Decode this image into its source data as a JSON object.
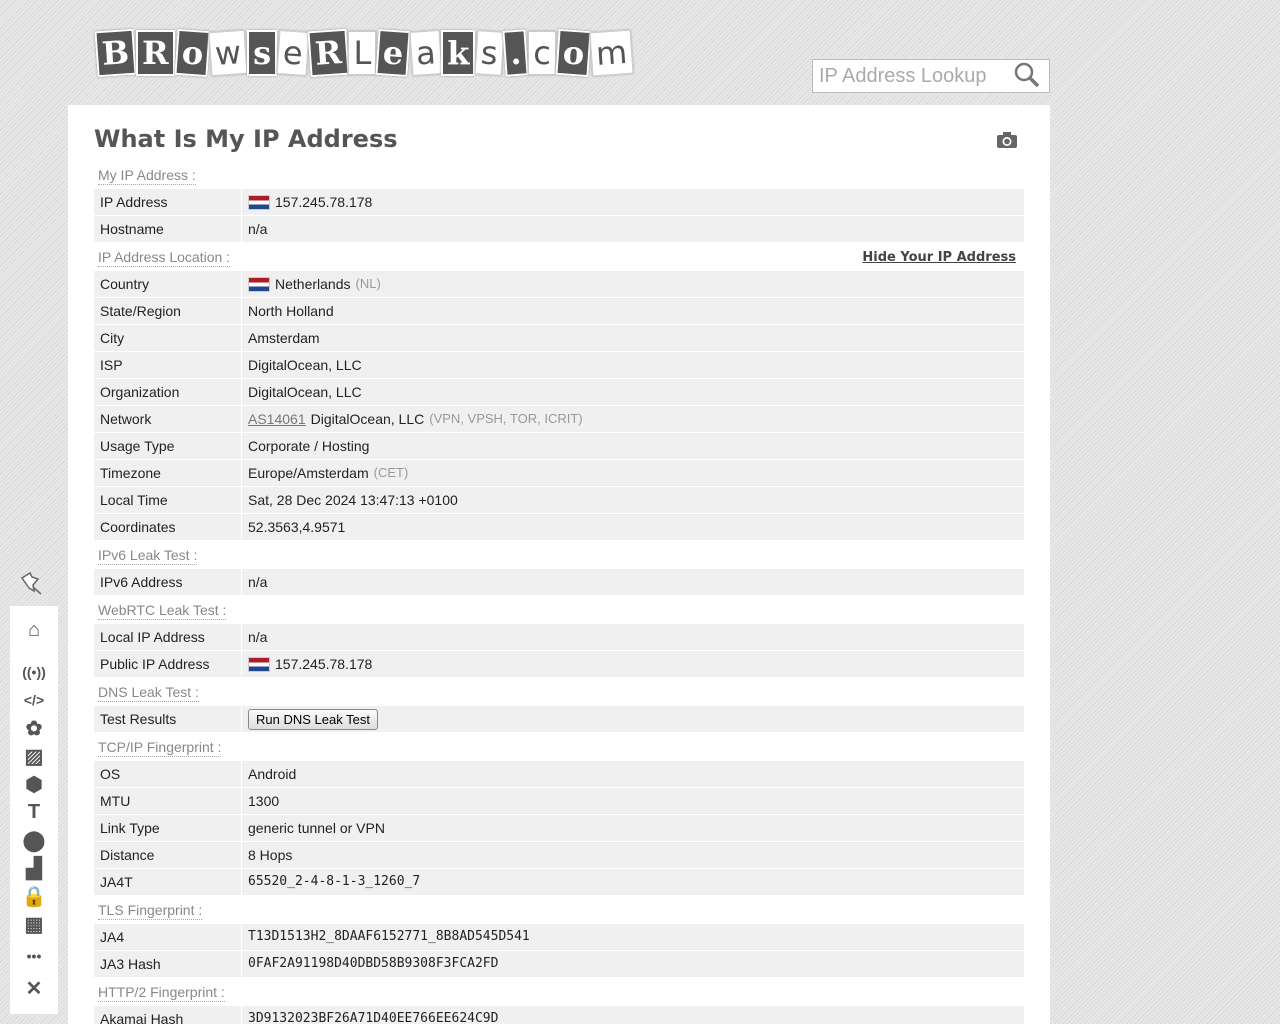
{
  "logo": {
    "text": "BRowseRLeaks.com",
    "letters": [
      "B",
      "R",
      "o",
      "w",
      "s",
      "e",
      "R",
      "L",
      "e",
      "a",
      "k",
      "s",
      ".",
      "c",
      "o",
      "m"
    ]
  },
  "search": {
    "placeholder": "IP Address Lookup"
  },
  "page_title": "What Is My IP Address",
  "sections": [
    {
      "header": "My IP Address :",
      "rows": [
        {
          "key": "IP Address",
          "value": "157.245.78.178",
          "flag": true
        },
        {
          "key": "Hostname",
          "value": "n/a"
        }
      ]
    },
    {
      "header": "IP Address Location :",
      "link": "Hide Your IP Address",
      "rows": [
        {
          "key": "Country",
          "value": "Netherlands",
          "extra": "(NL)",
          "flag": true
        },
        {
          "key": "State/Region",
          "value": "North Holland"
        },
        {
          "key": "City",
          "value": "Amsterdam"
        },
        {
          "key": "ISP",
          "value": "DigitalOcean, LLC"
        },
        {
          "key": "Organization",
          "value": "DigitalOcean, LLC"
        },
        {
          "key": "Network",
          "asn": "AS14061",
          "value": "DigitalOcean, LLC",
          "extra": "(VPN, VPSH, TOR, ICRIT)"
        },
        {
          "key": "Usage Type",
          "value": "Corporate / Hosting"
        },
        {
          "key": "Timezone",
          "value": "Europe/Amsterdam",
          "extra": "(CET)"
        },
        {
          "key": "Local Time",
          "value": "Sat, 28 Dec 2024 13:47:13 +0100"
        },
        {
          "key": "Coordinates",
          "value": "52.3563,4.9571"
        }
      ]
    },
    {
      "header": "IPv6 Leak Test :",
      "rows": [
        {
          "key": "IPv6 Address",
          "value": "n/a"
        }
      ]
    },
    {
      "header": "WebRTC Leak Test :",
      "rows": [
        {
          "key": "Local IP Address",
          "value": "n/a"
        },
        {
          "key": "Public IP Address",
          "value": "157.245.78.178",
          "flag": true
        }
      ]
    },
    {
      "header": "DNS Leak Test :",
      "rows": [
        {
          "key": "Test Results",
          "button": "Run DNS Leak Test"
        }
      ]
    },
    {
      "header": "TCP/IP Fingerprint :",
      "rows": [
        {
          "key": "OS",
          "value": "Android"
        },
        {
          "key": "MTU",
          "value": "1300"
        },
        {
          "key": "Link Type",
          "value": "generic tunnel or VPN"
        },
        {
          "key": "Distance",
          "value": "8 Hops"
        },
        {
          "key": "JA4T",
          "value": "65520_2-4-8-1-3_1260_7",
          "mono": true
        }
      ]
    },
    {
      "header": "TLS Fingerprint :",
      "rows": [
        {
          "key": "JA4",
          "value": "T13D1513H2_8DAAF6152771_8B8AD545D541",
          "mono": true
        },
        {
          "key": "JA3 Hash",
          "value": "0FAF2A91198D40DBD58B9308F3FCA2FD",
          "mono": true
        }
      ]
    },
    {
      "header": "HTTP/2 Fingerprint :",
      "rows": [
        {
          "key": "Akamai Hash",
          "value": "3D9132023BF26A71D40EE766EE624C9D",
          "mono": true
        }
      ]
    }
  ],
  "sidebar": [
    "home",
    "radio",
    "code",
    "canvas",
    "image",
    "cube",
    "font",
    "location",
    "steps",
    "lock",
    "firewall",
    "more",
    "tools"
  ]
}
